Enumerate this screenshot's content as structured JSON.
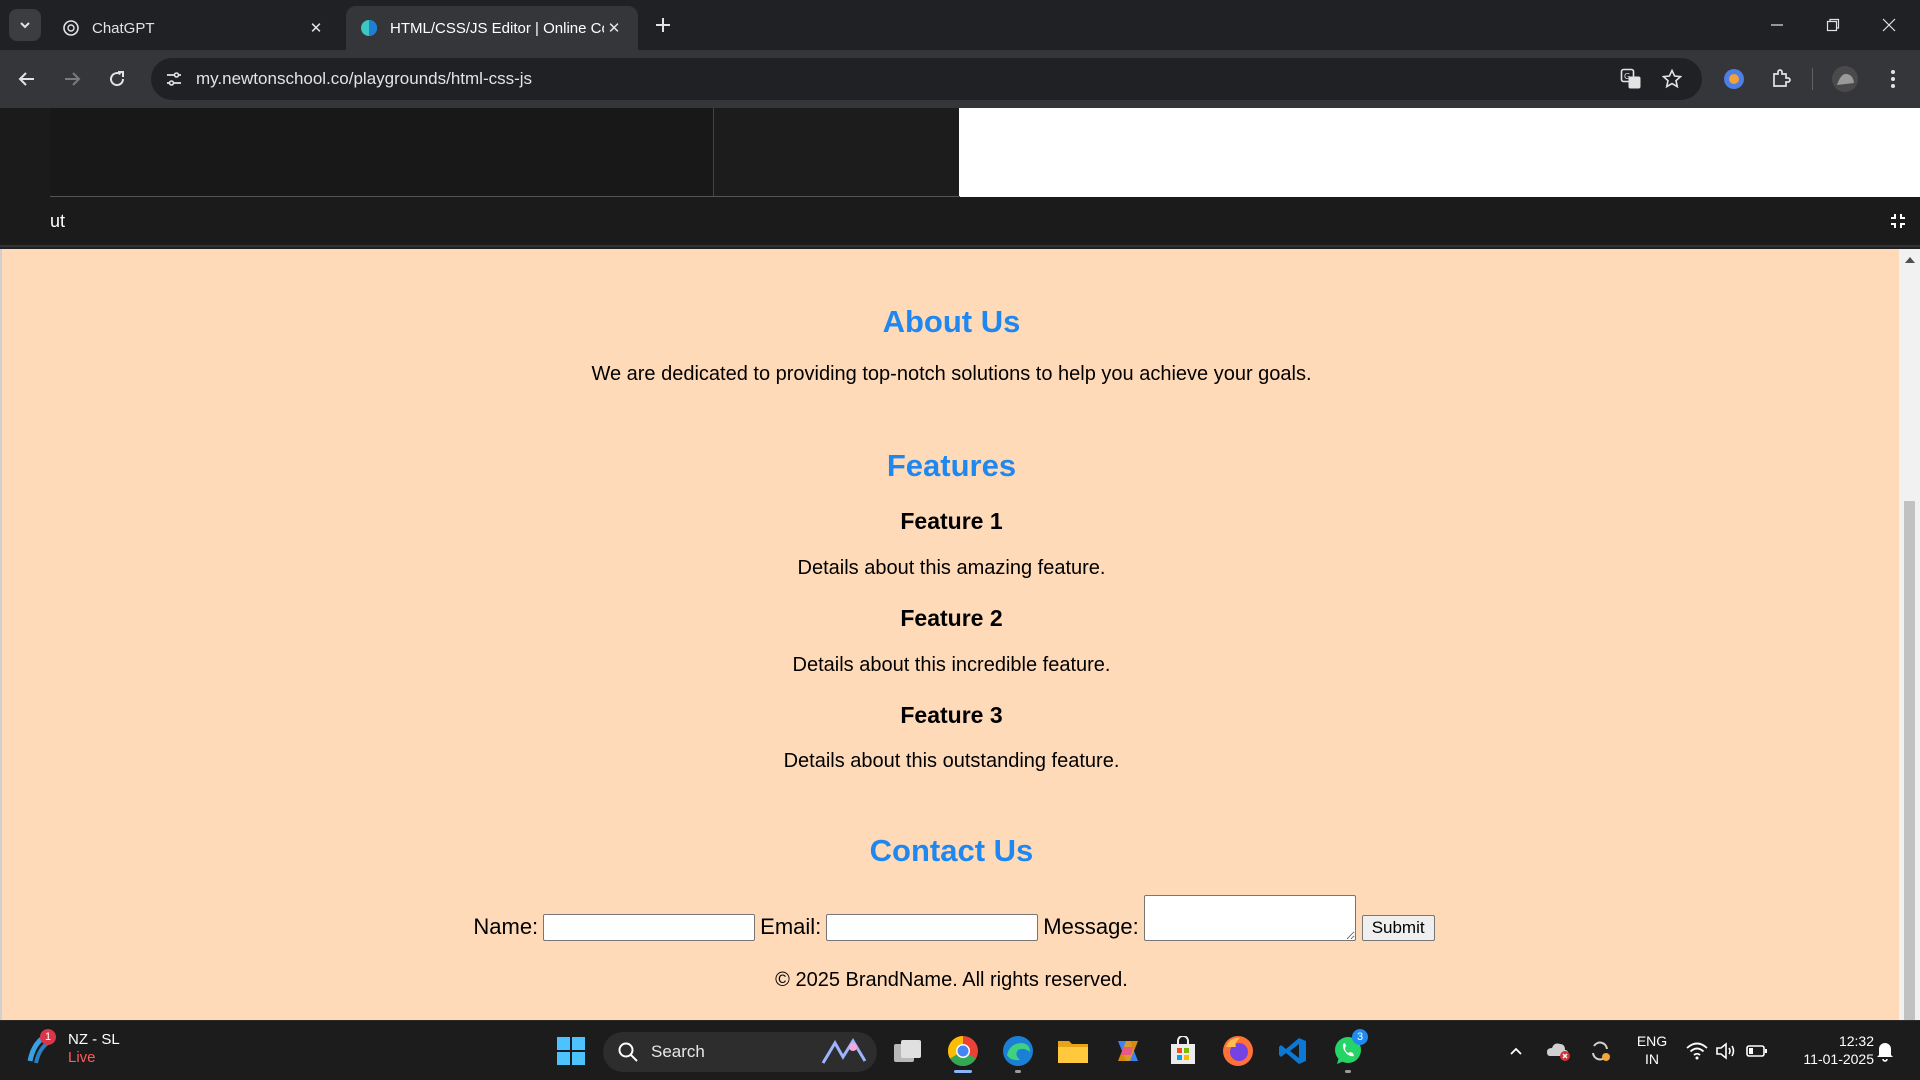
{
  "browser": {
    "tabs": [
      {
        "title": "ChatGPT",
        "active": false
      },
      {
        "title": "HTML/CSS/JS Editor | Online Co",
        "active": true
      }
    ],
    "url": "my.newtonschool.co/playgrounds/html-css-js"
  },
  "editor": {
    "output_label": "ut"
  },
  "preview": {
    "about": {
      "heading": "About Us",
      "text": "We are dedicated to providing top-notch solutions to help you achieve your goals."
    },
    "features": {
      "heading": "Features",
      "items": [
        {
          "title": "Feature 1",
          "text": "Details about this amazing feature."
        },
        {
          "title": "Feature 2",
          "text": "Details about this incredible feature."
        },
        {
          "title": "Feature 3",
          "text": "Details about this outstanding feature."
        }
      ]
    },
    "contact": {
      "heading": "Contact Us",
      "name_label": "Name:",
      "email_label": "Email:",
      "message_label": "Message:",
      "submit_label": "Submit"
    },
    "footer": "© 2025 BrandName. All rights reserved.",
    "colors": {
      "background": "#ffdab9",
      "heading": "#1e88f0"
    }
  },
  "taskbar": {
    "weather": {
      "location": "NZ - SL",
      "status": "Live",
      "badge": "1"
    },
    "search_label": "Search",
    "whatsapp_badge": "3",
    "language": {
      "line1": "ENG",
      "line2": "IN"
    },
    "clock": {
      "time": "12:32",
      "date": "11-01-2025"
    }
  }
}
